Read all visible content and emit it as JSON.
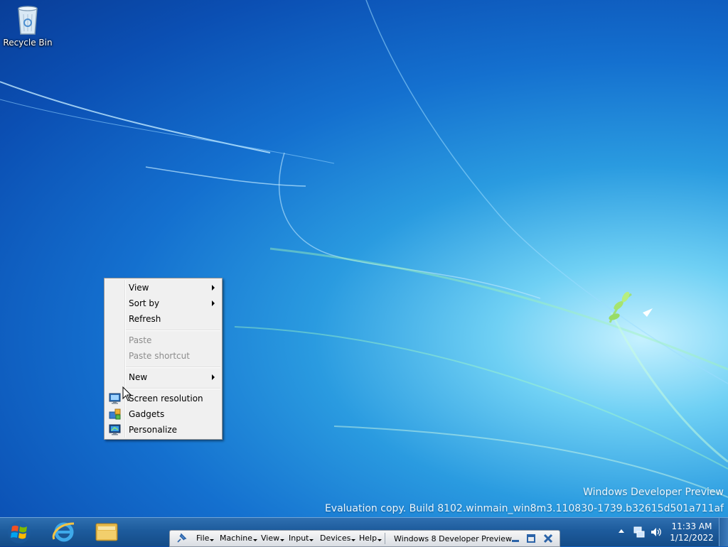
{
  "desktop": {
    "icons": [
      {
        "label": "Recycle Bin",
        "icon": "recycle-bin-icon"
      }
    ],
    "watermark": {
      "line1": "Windows Developer Preview",
      "line2": "Evaluation copy. Build 8102.winmain_win8m3.110830-1739.b32615d501a711af"
    }
  },
  "context_menu": {
    "items": [
      {
        "label": "View",
        "submenu": true,
        "enabled": true
      },
      {
        "label": "Sort by",
        "submenu": true,
        "enabled": true
      },
      {
        "label": "Refresh",
        "enabled": true
      },
      {
        "label": "Paste",
        "enabled": false
      },
      {
        "label": "Paste shortcut",
        "enabled": false
      },
      {
        "label": "New",
        "submenu": true,
        "enabled": true
      },
      {
        "label": "Screen resolution",
        "icon": "screen-resolution-icon",
        "enabled": true
      },
      {
        "label": "Gadgets",
        "icon": "gadgets-icon",
        "enabled": true
      },
      {
        "label": "Personalize",
        "icon": "personalize-icon",
        "enabled": true
      }
    ]
  },
  "taskbar": {
    "start_icon": "windows-logo-icon",
    "pinned": [
      "internet-explorer-icon",
      "windows-explorer-icon"
    ],
    "vm_toolbar": {
      "menus": [
        "File",
        "Machine",
        "View",
        "Input",
        "Devices",
        "Help"
      ],
      "title": "Windows 8 Developer Preview"
    },
    "clock": {
      "time": "11:33 AM",
      "date": "1/12/2022"
    }
  },
  "colors": {
    "desktop_accent": "#1470cf",
    "taskbar": "#1d5b9c",
    "menu_bg": "#f0f0f0",
    "disabled_text": "#8d8d8d"
  }
}
